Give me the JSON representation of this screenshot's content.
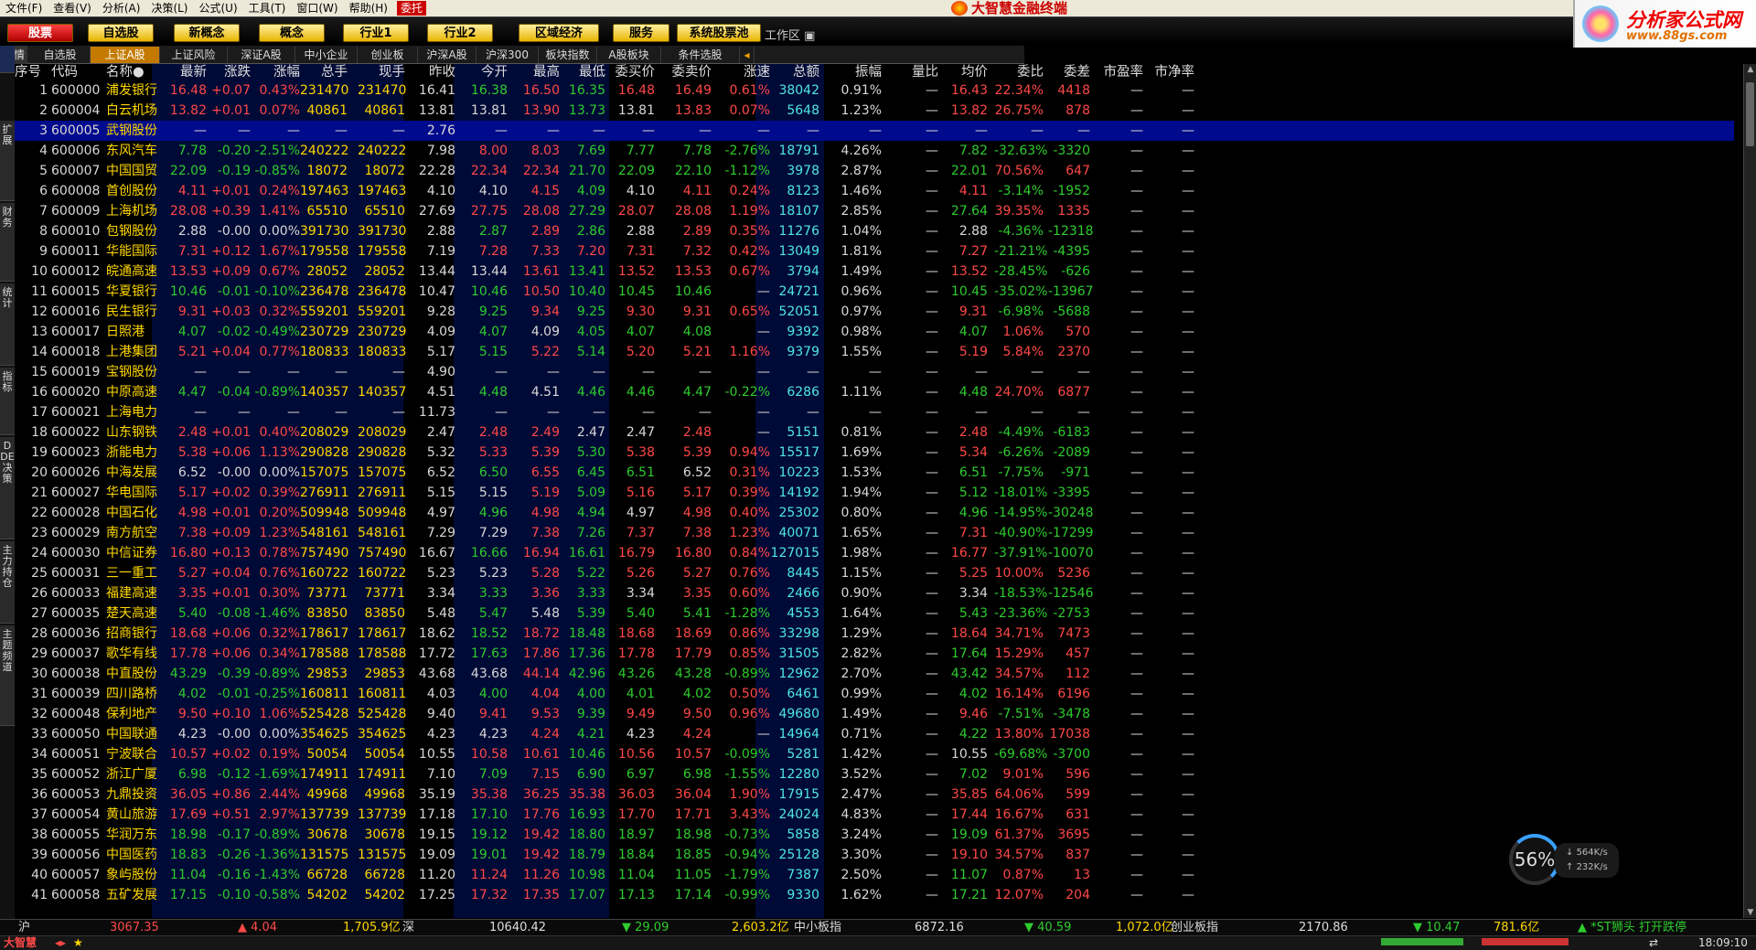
{
  "menu": [
    "文件(F)",
    "查看(V)",
    "分析(A)",
    "决策(L)",
    "公式(U)",
    "工具(T)",
    "窗口(W)",
    "帮助(H)"
  ],
  "menu_trade": "委托",
  "app_title": "大智慧金融终端",
  "toolbar": [
    "股票",
    "自选股",
    "新概念",
    "概念",
    "行业1",
    "行业2",
    "区域经济",
    "服务",
    "系统股票池"
  ],
  "workarea": "工作区",
  "banner": {
    "t1": "分析家公式网",
    "t2": "www.88gs.com"
  },
  "tabs_label": "行情",
  "tabs": [
    "自选股",
    "上证A股",
    "上证风险",
    "深证A股",
    "中小企业",
    "创业板",
    "沪深A股",
    "沪深300",
    "板块指数",
    "A股板块",
    "条件选股"
  ],
  "sidebar": [
    "扩展",
    "财务",
    "统计",
    "指标",
    "DDE决策",
    "主力持仓",
    "主题频道"
  ],
  "headers": [
    "序号",
    "代码",
    "名称●",
    "最新",
    "涨跌",
    "涨幅",
    "总手",
    "现手",
    "昨收",
    "今开",
    "最高",
    "最低",
    "委买价",
    "委卖价",
    "涨速",
    "总额",
    "振幅",
    "量比",
    "均价",
    "委比",
    "委差",
    "市盈率",
    "市净率"
  ],
  "rows": [
    [
      "1",
      "600000",
      "浦发银行",
      "16.48",
      "+0.07",
      "0.43%",
      "231470",
      "231470",
      "16.41",
      "16.38",
      "16.50",
      "16.35",
      "16.48",
      "16.49",
      "0.61%",
      "38042",
      "0.91%",
      "—",
      "16.43",
      "22.34%",
      "4418",
      "—",
      "—"
    ],
    [
      "2",
      "600004",
      "白云机场",
      "13.82",
      "+0.01",
      "0.07%",
      "40861",
      "40861",
      "13.81",
      "13.81",
      "13.90",
      "13.73",
      "13.81",
      "13.83",
      "0.07%",
      "5648",
      "1.23%",
      "—",
      "13.82",
      "26.75%",
      "878",
      "—",
      "—"
    ],
    [
      "3",
      "600005",
      "武钢股份",
      "—",
      "—",
      "—",
      "—",
      "—",
      "2.76",
      "—",
      "—",
      "—",
      "—",
      "—",
      "—",
      "—",
      "—",
      "—",
      "—",
      "—",
      "—",
      "—",
      "—"
    ],
    [
      "4",
      "600006",
      "东风汽车",
      "7.78",
      "-0.20",
      "-2.51%",
      "240222",
      "240222",
      "7.98",
      "8.00",
      "8.03",
      "7.69",
      "7.77",
      "7.78",
      "-2.76%",
      "18791",
      "4.26%",
      "—",
      "7.82",
      "-32.63%",
      "-3320",
      "—",
      "—"
    ],
    [
      "5",
      "600007",
      "中国国贸",
      "22.09",
      "-0.19",
      "-0.85%",
      "18072",
      "18072",
      "22.28",
      "22.34",
      "22.34",
      "21.70",
      "22.09",
      "22.10",
      "-1.12%",
      "3978",
      "2.87%",
      "—",
      "22.01",
      "70.56%",
      "647",
      "—",
      "—"
    ],
    [
      "6",
      "600008",
      "首创股份",
      "4.11",
      "+0.01",
      "0.24%",
      "197463",
      "197463",
      "4.10",
      "4.10",
      "4.15",
      "4.09",
      "4.10",
      "4.11",
      "0.24%",
      "8123",
      "1.46%",
      "—",
      "4.11",
      "-3.14%",
      "-1952",
      "—",
      "—"
    ],
    [
      "7",
      "600009",
      "上海机场",
      "28.08",
      "+0.39",
      "1.41%",
      "65510",
      "65510",
      "27.69",
      "27.75",
      "28.08",
      "27.29",
      "28.07",
      "28.08",
      "1.19%",
      "18107",
      "2.85%",
      "—",
      "27.64",
      "39.35%",
      "1335",
      "—",
      "—"
    ],
    [
      "8",
      "600010",
      "包钢股份",
      "2.88",
      "-0.00",
      "0.00%",
      "391730",
      "391730",
      "2.88",
      "2.87",
      "2.89",
      "2.86",
      "2.88",
      "2.89",
      "0.35%",
      "11276",
      "1.04%",
      "—",
      "2.88",
      "-4.36%",
      "-12318",
      "—",
      "—"
    ],
    [
      "9",
      "600011",
      "华能国际",
      "7.31",
      "+0.12",
      "1.67%",
      "179558",
      "179558",
      "7.19",
      "7.28",
      "7.33",
      "7.20",
      "7.31",
      "7.32",
      "0.42%",
      "13049",
      "1.81%",
      "—",
      "7.27",
      "-21.21%",
      "-4395",
      "—",
      "—"
    ],
    [
      "10",
      "600012",
      "皖通高速",
      "13.53",
      "+0.09",
      "0.67%",
      "28052",
      "28052",
      "13.44",
      "13.44",
      "13.61",
      "13.41",
      "13.52",
      "13.53",
      "0.67%",
      "3794",
      "1.49%",
      "—",
      "13.52",
      "-28.45%",
      "-626",
      "—",
      "—"
    ],
    [
      "11",
      "600015",
      "华夏银行",
      "10.46",
      "-0.01",
      "-0.10%",
      "236478",
      "236478",
      "10.47",
      "10.46",
      "10.50",
      "10.40",
      "10.45",
      "10.46",
      "—",
      "24721",
      "0.96%",
      "—",
      "10.45",
      "-35.02%",
      "-13967",
      "—",
      "—"
    ],
    [
      "12",
      "600016",
      "民生银行",
      "9.31",
      "+0.03",
      "0.32%",
      "559201",
      "559201",
      "9.28",
      "9.25",
      "9.34",
      "9.25",
      "9.30",
      "9.31",
      "0.65%",
      "52051",
      "0.97%",
      "—",
      "9.31",
      "-6.98%",
      "-5688",
      "—",
      "—"
    ],
    [
      "13",
      "600017",
      "日照港",
      "4.07",
      "-0.02",
      "-0.49%",
      "230729",
      "230729",
      "4.09",
      "4.07",
      "4.09",
      "4.05",
      "4.07",
      "4.08",
      "—",
      "9392",
      "0.98%",
      "—",
      "4.07",
      "1.06%",
      "570",
      "—",
      "—"
    ],
    [
      "14",
      "600018",
      "上港集团",
      "5.21",
      "+0.04",
      "0.77%",
      "180833",
      "180833",
      "5.17",
      "5.15",
      "5.22",
      "5.14",
      "5.20",
      "5.21",
      "1.16%",
      "9379",
      "1.55%",
      "—",
      "5.19",
      "5.84%",
      "2370",
      "—",
      "—"
    ],
    [
      "15",
      "600019",
      "宝钢股份",
      "—",
      "—",
      "—",
      "—",
      "—",
      "4.90",
      "—",
      "—",
      "—",
      "—",
      "—",
      "—",
      "—",
      "—",
      "—",
      "—",
      "—",
      "—",
      "—",
      "—"
    ],
    [
      "16",
      "600020",
      "中原高速",
      "4.47",
      "-0.04",
      "-0.89%",
      "140357",
      "140357",
      "4.51",
      "4.48",
      "4.51",
      "4.46",
      "4.46",
      "4.47",
      "-0.22%",
      "6286",
      "1.11%",
      "—",
      "4.48",
      "24.70%",
      "6877",
      "—",
      "—"
    ],
    [
      "17",
      "600021",
      "上海电力",
      "—",
      "—",
      "—",
      "—",
      "—",
      "11.73",
      "—",
      "—",
      "—",
      "—",
      "—",
      "—",
      "—",
      "—",
      "—",
      "—",
      "—",
      "—",
      "—",
      "—"
    ],
    [
      "18",
      "600022",
      "山东钢铁",
      "2.48",
      "+0.01",
      "0.40%",
      "208029",
      "208029",
      "2.47",
      "2.48",
      "2.49",
      "2.47",
      "2.47",
      "2.48",
      "—",
      "5151",
      "0.81%",
      "—",
      "2.48",
      "-4.49%",
      "-6183",
      "—",
      "—"
    ],
    [
      "19",
      "600023",
      "浙能电力",
      "5.38",
      "+0.06",
      "1.13%",
      "290828",
      "290828",
      "5.32",
      "5.33",
      "5.39",
      "5.30",
      "5.38",
      "5.39",
      "0.94%",
      "15517",
      "1.69%",
      "—",
      "5.34",
      "-6.26%",
      "-2089",
      "—",
      "—"
    ],
    [
      "20",
      "600026",
      "中海发展",
      "6.52",
      "-0.00",
      "0.00%",
      "157075",
      "157075",
      "6.52",
      "6.50",
      "6.55",
      "6.45",
      "6.51",
      "6.52",
      "0.31%",
      "10223",
      "1.53%",
      "—",
      "6.51",
      "-7.75%",
      "-971",
      "—",
      "—"
    ],
    [
      "21",
      "600027",
      "华电国际",
      "5.17",
      "+0.02",
      "0.39%",
      "276911",
      "276911",
      "5.15",
      "5.15",
      "5.19",
      "5.09",
      "5.16",
      "5.17",
      "0.39%",
      "14192",
      "1.94%",
      "—",
      "5.12",
      "-18.01%",
      "-3395",
      "—",
      "—"
    ],
    [
      "22",
      "600028",
      "中国石化",
      "4.98",
      "+0.01",
      "0.20%",
      "509948",
      "509948",
      "4.97",
      "4.96",
      "4.98",
      "4.94",
      "4.97",
      "4.98",
      "0.40%",
      "25302",
      "0.80%",
      "—",
      "4.96",
      "-14.95%",
      "-30248",
      "—",
      "—"
    ],
    [
      "23",
      "600029",
      "南方航空",
      "7.38",
      "+0.09",
      "1.23%",
      "548161",
      "548161",
      "7.29",
      "7.29",
      "7.38",
      "7.26",
      "7.37",
      "7.38",
      "1.23%",
      "40071",
      "1.65%",
      "—",
      "7.31",
      "-40.90%",
      "-17299",
      "—",
      "—"
    ],
    [
      "24",
      "600030",
      "中信证券",
      "16.80",
      "+0.13",
      "0.78%",
      "757490",
      "757490",
      "16.67",
      "16.66",
      "16.94",
      "16.61",
      "16.79",
      "16.80",
      "0.84%",
      "127015",
      "1.98%",
      "—",
      "16.77",
      "-37.91%",
      "-10070",
      "—",
      "—"
    ],
    [
      "25",
      "600031",
      "三一重工",
      "5.27",
      "+0.04",
      "0.76%",
      "160722",
      "160722",
      "5.23",
      "5.23",
      "5.28",
      "5.22",
      "5.26",
      "5.27",
      "0.76%",
      "8445",
      "1.15%",
      "—",
      "5.25",
      "10.00%",
      "5236",
      "—",
      "—"
    ],
    [
      "26",
      "600033",
      "福建高速",
      "3.35",
      "+0.01",
      "0.30%",
      "73771",
      "73771",
      "3.34",
      "3.33",
      "3.36",
      "3.33",
      "3.34",
      "3.35",
      "0.60%",
      "2466",
      "0.90%",
      "—",
      "3.34",
      "-18.53%",
      "-12546",
      "—",
      "—"
    ],
    [
      "27",
      "600035",
      "楚天高速",
      "5.40",
      "-0.08",
      "-1.46%",
      "83850",
      "83850",
      "5.48",
      "5.47",
      "5.48",
      "5.39",
      "5.40",
      "5.41",
      "-1.28%",
      "4553",
      "1.64%",
      "—",
      "5.43",
      "-23.36%",
      "-2753",
      "—",
      "—"
    ],
    [
      "28",
      "600036",
      "招商银行",
      "18.68",
      "+0.06",
      "0.32%",
      "178617",
      "178617",
      "18.62",
      "18.52",
      "18.72",
      "18.48",
      "18.68",
      "18.69",
      "0.86%",
      "33298",
      "1.29%",
      "—",
      "18.64",
      "34.71%",
      "7473",
      "—",
      "—"
    ],
    [
      "29",
      "600037",
      "歌华有线",
      "17.78",
      "+0.06",
      "0.34%",
      "178588",
      "178588",
      "17.72",
      "17.63",
      "17.86",
      "17.36",
      "17.78",
      "17.79",
      "0.85%",
      "31505",
      "2.82%",
      "—",
      "17.64",
      "15.29%",
      "457",
      "—",
      "—"
    ],
    [
      "30",
      "600038",
      "中直股份",
      "43.29",
      "-0.39",
      "-0.89%",
      "29853",
      "29853",
      "43.68",
      "43.68",
      "44.14",
      "42.96",
      "43.26",
      "43.28",
      "-0.89%",
      "12962",
      "2.70%",
      "—",
      "43.42",
      "34.57%",
      "112",
      "—",
      "—"
    ],
    [
      "31",
      "600039",
      "四川路桥",
      "4.02",
      "-0.01",
      "-0.25%",
      "160811",
      "160811",
      "4.03",
      "4.00",
      "4.04",
      "4.00",
      "4.01",
      "4.02",
      "0.50%",
      "6461",
      "0.99%",
      "—",
      "4.02",
      "16.14%",
      "6196",
      "—",
      "—"
    ],
    [
      "32",
      "600048",
      "保利地产",
      "9.50",
      "+0.10",
      "1.06%",
      "525428",
      "525428",
      "9.40",
      "9.41",
      "9.53",
      "9.39",
      "9.49",
      "9.50",
      "0.96%",
      "49680",
      "1.49%",
      "—",
      "9.46",
      "-7.51%",
      "-3478",
      "—",
      "—"
    ],
    [
      "33",
      "600050",
      "中国联通",
      "4.23",
      "-0.00",
      "0.00%",
      "354625",
      "354625",
      "4.23",
      "4.23",
      "4.24",
      "4.21",
      "4.23",
      "4.24",
      "—",
      "14964",
      "0.71%",
      "—",
      "4.22",
      "13.80%",
      "17038",
      "—",
      "—"
    ],
    [
      "34",
      "600051",
      "宁波联合",
      "10.57",
      "+0.02",
      "0.19%",
      "50054",
      "50054",
      "10.55",
      "10.58",
      "10.61",
      "10.46",
      "10.56",
      "10.57",
      "-0.09%",
      "5281",
      "1.42%",
      "—",
      "10.55",
      "-69.68%",
      "-3700",
      "—",
      "—"
    ],
    [
      "35",
      "600052",
      "浙江广厦",
      "6.98",
      "-0.12",
      "-1.69%",
      "174911",
      "174911",
      "7.10",
      "7.09",
      "7.15",
      "6.90",
      "6.97",
      "6.98",
      "-1.55%",
      "12280",
      "3.52%",
      "—",
      "7.02",
      "9.01%",
      "596",
      "—",
      "—"
    ],
    [
      "36",
      "600053",
      "九鼎投资",
      "36.05",
      "+0.86",
      "2.44%",
      "49968",
      "49968",
      "35.19",
      "35.38",
      "36.25",
      "35.38",
      "36.03",
      "36.04",
      "1.90%",
      "17915",
      "2.47%",
      "—",
      "35.85",
      "64.06%",
      "599",
      "—",
      "—"
    ],
    [
      "37",
      "600054",
      "黄山旅游",
      "17.69",
      "+0.51",
      "2.97%",
      "137739",
      "137739",
      "17.18",
      "17.10",
      "17.76",
      "16.93",
      "17.70",
      "17.71",
      "3.43%",
      "24024",
      "4.83%",
      "—",
      "17.44",
      "16.67%",
      "631",
      "—",
      "—"
    ],
    [
      "38",
      "600055",
      "华润万东",
      "18.98",
      "-0.17",
      "-0.89%",
      "30678",
      "30678",
      "19.15",
      "19.12",
      "19.42",
      "18.80",
      "18.97",
      "18.98",
      "-0.73%",
      "5858",
      "3.24%",
      "—",
      "19.09",
      "61.37%",
      "3695",
      "—",
      "—"
    ],
    [
      "39",
      "600056",
      "中国医药",
      "18.83",
      "-0.26",
      "-1.36%",
      "131575",
      "131575",
      "19.09",
      "19.01",
      "19.42",
      "18.79",
      "18.84",
      "18.85",
      "-0.94%",
      "25128",
      "3.30%",
      "—",
      "19.10",
      "34.57%",
      "837",
      "—",
      "—"
    ],
    [
      "40",
      "600057",
      "象屿股份",
      "11.04",
      "-0.16",
      "-1.43%",
      "66728",
      "66728",
      "11.20",
      "11.24",
      "11.26",
      "10.98",
      "11.04",
      "11.05",
      "-1.79%",
      "7387",
      "2.50%",
      "—",
      "11.07",
      "0.87%",
      "13",
      "—",
      "—"
    ],
    [
      "41",
      "600058",
      "五矿发展",
      "17.15",
      "-0.10",
      "-0.58%",
      "54202",
      "54202",
      "17.25",
      "17.32",
      "17.35",
      "17.07",
      "17.13",
      "17.14",
      "-0.99%",
      "9330",
      "1.62%",
      "—",
      "17.21",
      "12.07%",
      "204",
      "—",
      "—"
    ]
  ],
  "speed": {
    "pct": "56%",
    "down": "564K/s",
    "up": "232K/s"
  },
  "status": {
    "sh_label": "沪",
    "sh_index": "3067.35",
    "sh_chg": "▲ 4.04",
    "sh_amt": "1,705.9亿",
    "sz_label": "深",
    "sz_index": "10640.42",
    "sz_chg": "▼ 29.09",
    "sz_amt": "2,603.2亿",
    "zx_label": "中小板指",
    "zx_index": "6872.16",
    "zx_chg": "▼ 40.59",
    "zx_amt": "1,072.0亿",
    "cy_label": "创业板指",
    "cy_index": "2170.86",
    "cy_chg": "▼ 10.47",
    "cy_amt": "781.6亿",
    "ticker": "▲ *ST狮头 打开跌停"
  },
  "bottom": {
    "brand": "大智慧",
    "time": "18:09:10"
  },
  "colors": {
    "up": "#ff4848",
    "down": "#2ecc2e",
    "flat": "#d8d8d8",
    "volume": "#ffd700",
    "selected_row": "#000a8c"
  }
}
